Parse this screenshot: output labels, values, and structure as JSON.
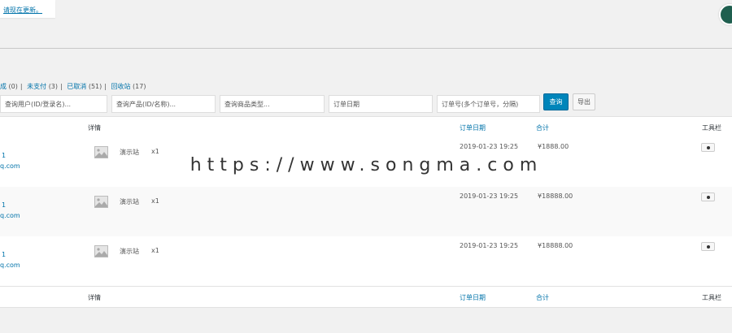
{
  "notice": {
    "link_text": "请现在更新。"
  },
  "views": [
    {
      "label": "成",
      "count": "(0)"
    },
    {
      "label": "未支付",
      "count": "(3)"
    },
    {
      "label": "已取消",
      "count": "(51)"
    },
    {
      "label": "回收站",
      "count": "(17)"
    }
  ],
  "filters": {
    "user_placeholder": "查询用户(ID/登录名)...",
    "product_placeholder": "查询产品(ID/名称)...",
    "type_placeholder": "查询商品类型...",
    "date_placeholder": "订单日期",
    "orderno_placeholder": "订单号(多个订单号，分隔)",
    "search_label": "查询",
    "export_label": "导出"
  },
  "columns": {
    "detail": "详情",
    "order_date": "订单日期",
    "total": "合计",
    "tools": "工具栏"
  },
  "rows": [
    {
      "user_id": "1",
      "email": "q.com",
      "product": "演示站",
      "qty": "x1",
      "date": "2019-01-23 19:25",
      "total": "¥1888.00"
    },
    {
      "user_id": "1",
      "email": "q.com",
      "product": "演示站",
      "qty": "x1",
      "date": "2019-01-23 19:25",
      "total": "¥18888.00"
    },
    {
      "user_id": "1",
      "email": "q.com",
      "product": "演示站",
      "qty": "x1",
      "date": "2019-01-23 19:25",
      "total": "¥18888.00"
    }
  ],
  "watermark": "https://www.songma.com",
  "icons": {
    "product_thumb": "image-placeholder-icon",
    "view": "view-icon"
  },
  "colors": {
    "link": "#0073aa",
    "primary_button": "#0085ba"
  }
}
